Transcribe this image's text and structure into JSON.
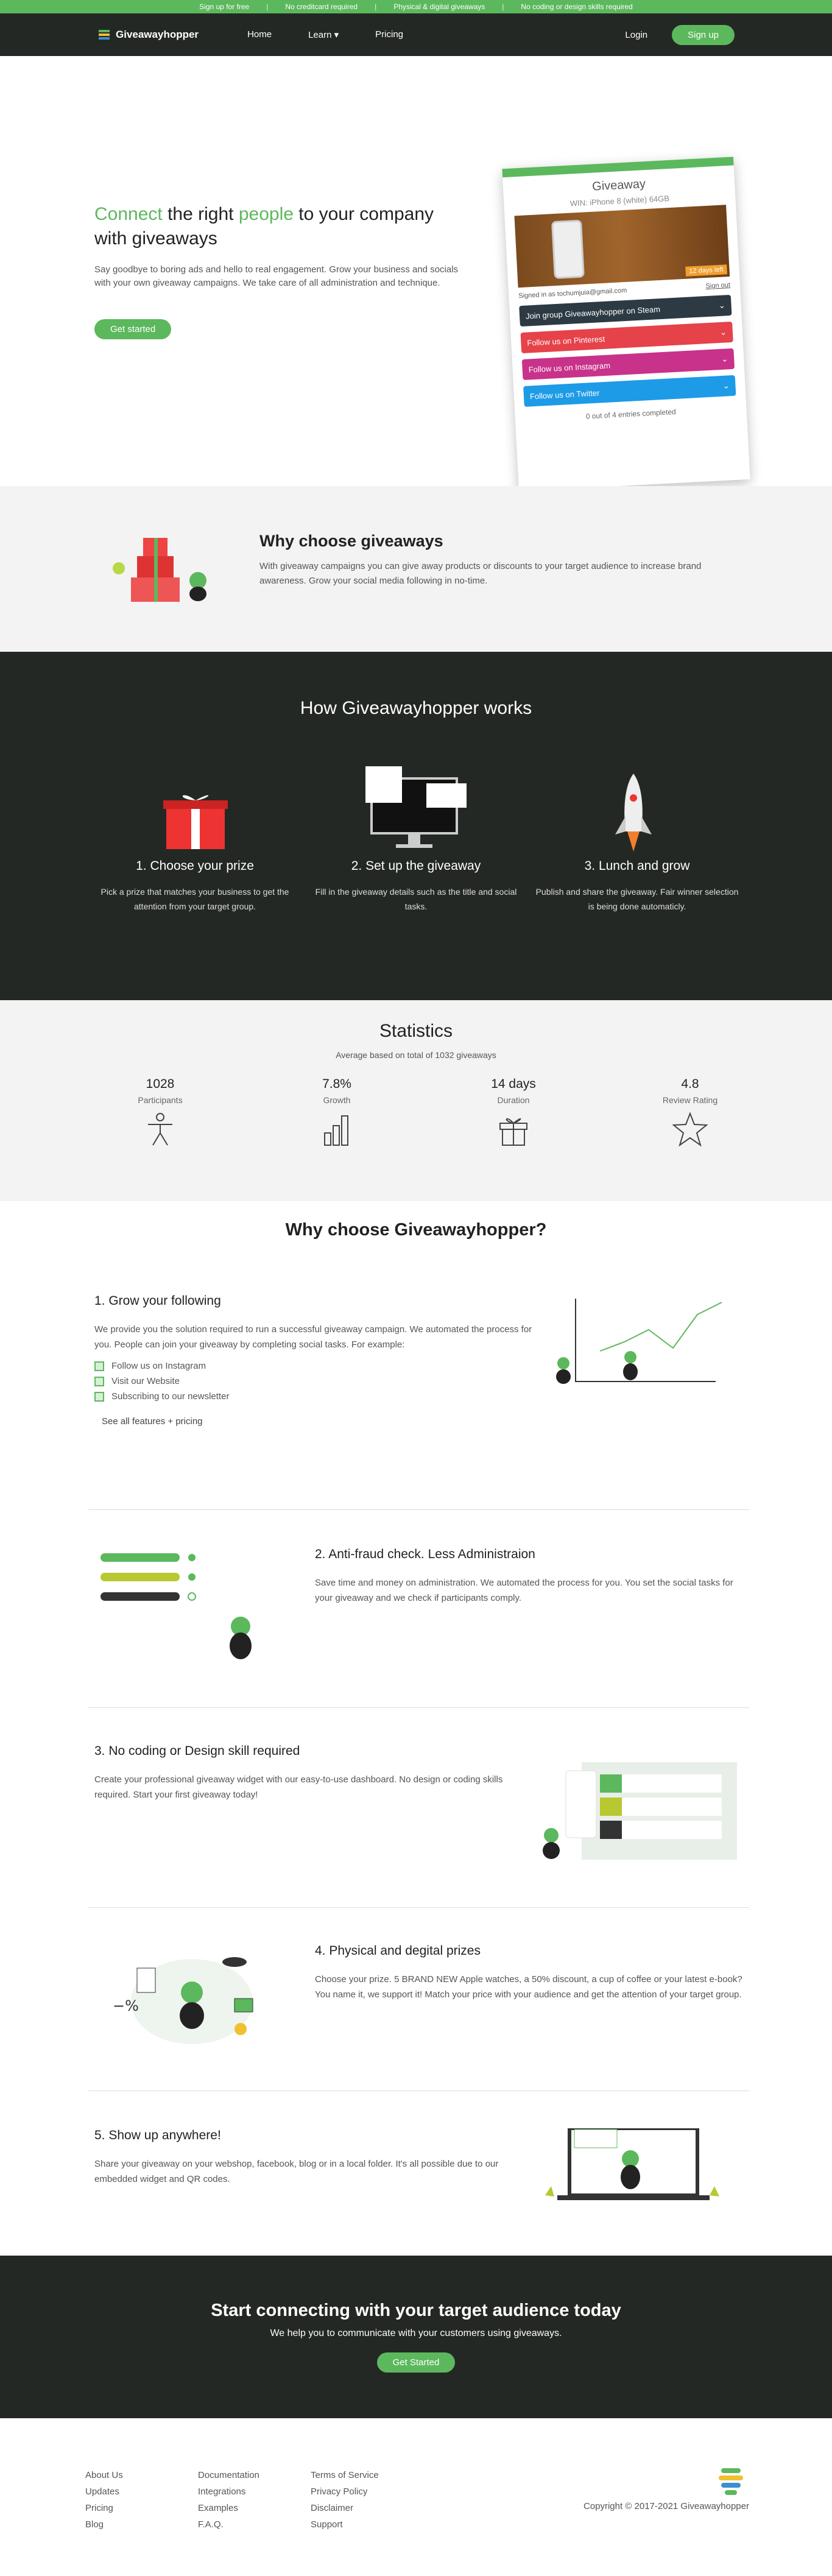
{
  "topbar": [
    "Sign up for free",
    "No creditcard required",
    "Physical & digital giveaways",
    "No coding or design skills required"
  ],
  "nav": {
    "brand": "Giveawayhopper",
    "links": [
      "Home",
      "Learn",
      "Pricing"
    ],
    "login": "Login",
    "signup": "Sign up"
  },
  "hero": {
    "h_a": "Connect",
    "h_b": " the right ",
    "h_c": "people",
    "h_d": " to your company with giveaways",
    "text": "Say goodbye to boring ads and hello to real engagement. Grow your business and socials with your own giveaway campaigns. We take care of all administration and technique.",
    "cta": "Get started"
  },
  "card": {
    "title": "Giveaway",
    "subtitle": "WIN: iPhone 8 (white) 64GB",
    "days": "12 days left",
    "signed": "Signed in as tochumjuia@gmail.com",
    "signout": "Sign out",
    "rows": [
      "Join group Giveawayhopper on Steam",
      "Follow us on Pinterest",
      "Follow us on Instagram",
      "Follow us on Twitter"
    ],
    "done": "0 out of 4 entries completed"
  },
  "colors": {
    "steam": "#2d3a43",
    "pinterest": "#e6424a",
    "instagram": "#c8328a",
    "twitter": "#1d9be7"
  },
  "why": {
    "title": "Why choose giveaways",
    "text": "With giveaway campaigns you can give away products or discounts to your target audience to increase brand awareness. Grow your social media following in no-time."
  },
  "how": {
    "title": "How Giveawayhopper works",
    "steps": [
      {
        "t": "1. Choose your prize",
        "d": "Pick a prize that matches your business to get the attention from your target group."
      },
      {
        "t": "2. Set up the giveaway",
        "d": "Fill in the giveaway details such as the title and social tasks."
      },
      {
        "t": "3. Lunch and grow",
        "d": "Publish and share the giveaway. Fair winner selection is being done automaticly."
      }
    ]
  },
  "stats": {
    "title": "Statistics",
    "sub": "Average based on total of 1032 giveaways",
    "items": [
      {
        "v": "1028",
        "l": "Participants"
      },
      {
        "v": "7.8%",
        "l": "Growth"
      },
      {
        "v": "14 days",
        "l": "Duration"
      },
      {
        "v": "4.8",
        "l": "Review Rating"
      }
    ]
  },
  "whyhop": "Why choose Giveawayhopper?",
  "features": [
    {
      "t": "1. Grow your following",
      "d": "We provide you the solution required to run a successful giveaway campaign. We automated the process for you. People can join your giveaway by completing social tasks. For example:",
      "items": [
        "Follow us on Instagram",
        "Visit our Website",
        "Subscribing to our newsletter"
      ],
      "link": "See all features + pricing"
    },
    {
      "t": "2. Anti-fraud check. Less Administraion",
      "d": "Save time and money on administration. We automated the process for you. You set the social tasks for your giveaway and we check if participants comply."
    },
    {
      "t": "3. No coding or Design skill required",
      "d": "Create your professional giveaway widget with our easy-to-use dashboard. No design or coding skills required. Start your first giveaway today!"
    },
    {
      "t": "4. Physical and degital prizes",
      "d": "Choose your prize. 5 BRAND NEW Apple watches, a 50% discount, a cup of coffee or your latest e-book? You name it, we support it! Match your price with your audience and get the attention of your target group."
    },
    {
      "t": "5. Show up anywhere!",
      "d": "Share your giveaway on your webshop, facebook, blog or in a local folder. It's all possible due to our embedded widget and QR codes."
    }
  ],
  "cta": {
    "title": "Start connecting with your target audience today",
    "text": "We help you to communicate with your customers using giveaways.",
    "btn": "Get Started"
  },
  "footer": {
    "c1": [
      "About Us",
      "Updates",
      "Pricing",
      "Blog"
    ],
    "c2": [
      "Documentation",
      "Integrations",
      "Examples",
      "F.A.Q."
    ],
    "c3": [
      "Terms of Service",
      "Privacy Policy",
      "Disclaimer",
      "Support"
    ],
    "copy": "Copyright © 2017-2021 Giveawayhopper"
  }
}
